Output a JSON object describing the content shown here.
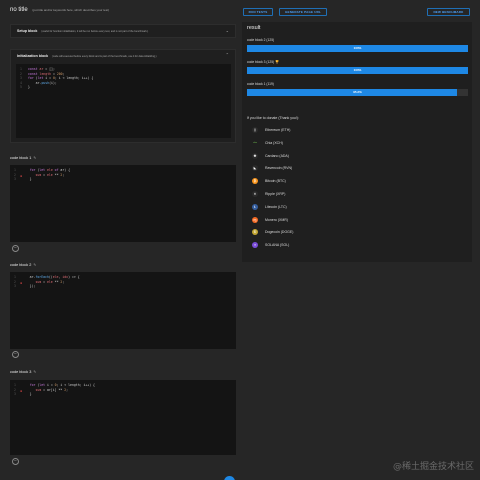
{
  "header": {
    "title": "no title",
    "subtitle": "(put title and/or keywords here, which describes your test)",
    "buttons": [
      "RUN TESTS",
      "GENERATE PAGE URL",
      "NEW BENCHMARK"
    ]
  },
  "setup": {
    "label": "Setup block",
    "note": "(useful for function initialization, it will be run before every test, and is not part of the benchmark.)"
  },
  "init": {
    "label": "Initialization block",
    "note": "(code will executed before every block and is part of the benchmark, use it for data initializing.)",
    "lines": [
      "1",
      "2",
      "3",
      "4",
      "5"
    ]
  },
  "blocks": [
    {
      "title": "code block 1",
      "lines": [
        "1",
        "2",
        "3"
      ]
    },
    {
      "title": "code block 2",
      "lines": [
        "1",
        "2",
        "3"
      ]
    },
    {
      "title": "code block 3",
      "lines": [
        "1",
        "2",
        "3"
      ]
    }
  ],
  "result": {
    "title": "result",
    "bars": [
      {
        "label": "code block 2 (125)",
        "value": 100,
        "text": "100%"
      },
      {
        "label": "code block 3 (125) 🏆",
        "value": 100,
        "text": "100%"
      },
      {
        "label": "code block 1 (119)",
        "value": 95.2,
        "text": "95.2%"
      }
    ],
    "donate_title": "If you like to donate (Thank you!):",
    "coins": [
      {
        "name": "Ethereum (ETH)",
        "icon": "ethereum-icon",
        "glyph": "⟠",
        "color": "#2a2a2a"
      },
      {
        "name": "Chia (XCH)",
        "icon": "chia-icon",
        "glyph": "chia",
        "color": "#2a2a2a"
      },
      {
        "name": "Cardano (ADA)",
        "icon": "cardano-icon",
        "glyph": "✺",
        "color": "#2a2a2a"
      },
      {
        "name": "Ravencoin (RVN)",
        "icon": "ravencoin-icon",
        "glyph": "◣",
        "color": "#2a2a2a"
      },
      {
        "name": "Bitcoin (BTC)",
        "icon": "bitcoin-icon",
        "glyph": "₿",
        "color": "#f7931a"
      },
      {
        "name": "Ripple (XRP)",
        "icon": "ripple-icon",
        "glyph": "✕",
        "color": "#2a2a2a"
      },
      {
        "name": "Litecoin (LTC)",
        "icon": "litecoin-icon",
        "glyph": "Ł",
        "color": "#345d9d"
      },
      {
        "name": "Monero (XMR)",
        "icon": "monero-icon",
        "glyph": "ɱ",
        "color": "#f26822"
      },
      {
        "name": "Dogecoin (DOGE)",
        "icon": "dogecoin-icon",
        "glyph": "Ð",
        "color": "#c2a633"
      },
      {
        "name": "SOLANA (SOL)",
        "icon": "solana-icon",
        "glyph": "≡",
        "color": "#7a4dd8"
      }
    ]
  },
  "watermark": "@稀土掘金技术社区"
}
